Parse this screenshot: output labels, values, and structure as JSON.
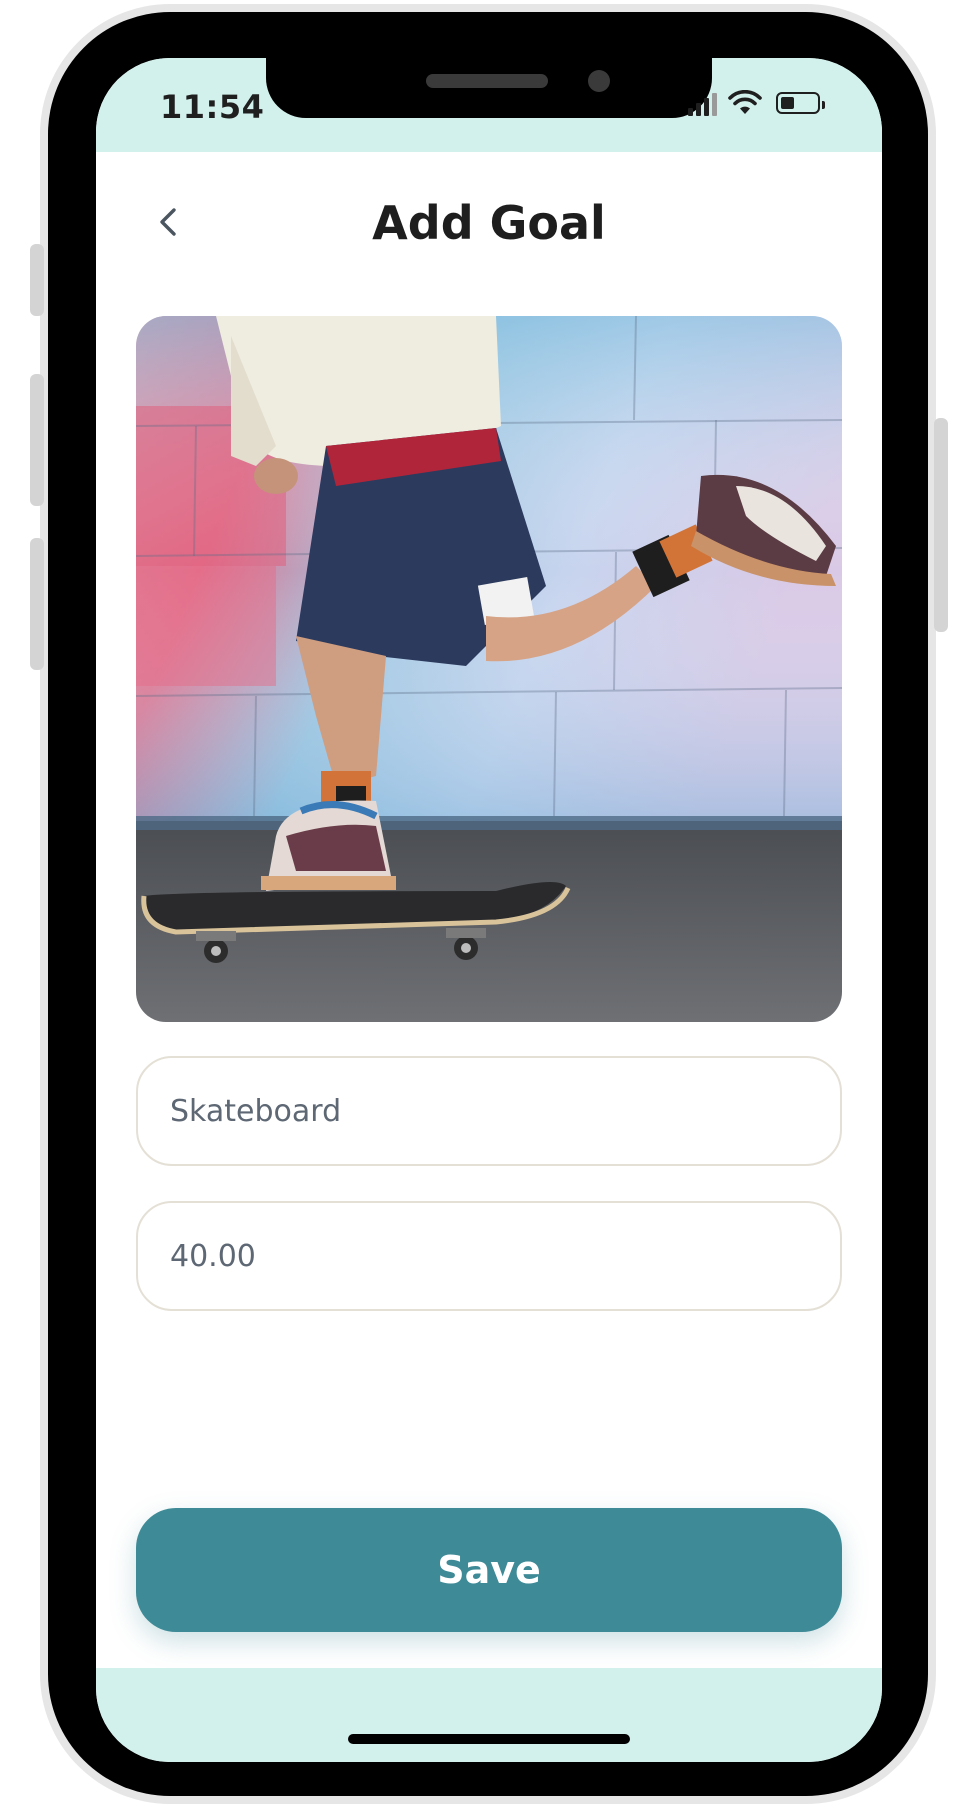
{
  "status_bar": {
    "time": "11:54"
  },
  "header": {
    "title": "Add Goal",
    "back_icon": "chevron-left-icon"
  },
  "goal_image": {
    "subject": "skateboarder"
  },
  "form": {
    "name_value": "Skateboard",
    "amount_value": "40.00"
  },
  "actions": {
    "save_label": "Save"
  },
  "colors": {
    "accent": "#3e8a96",
    "status_bar_bg": "#d3f1ec",
    "field_border": "#e4e0d6",
    "title_text": "#1e1e1e"
  }
}
